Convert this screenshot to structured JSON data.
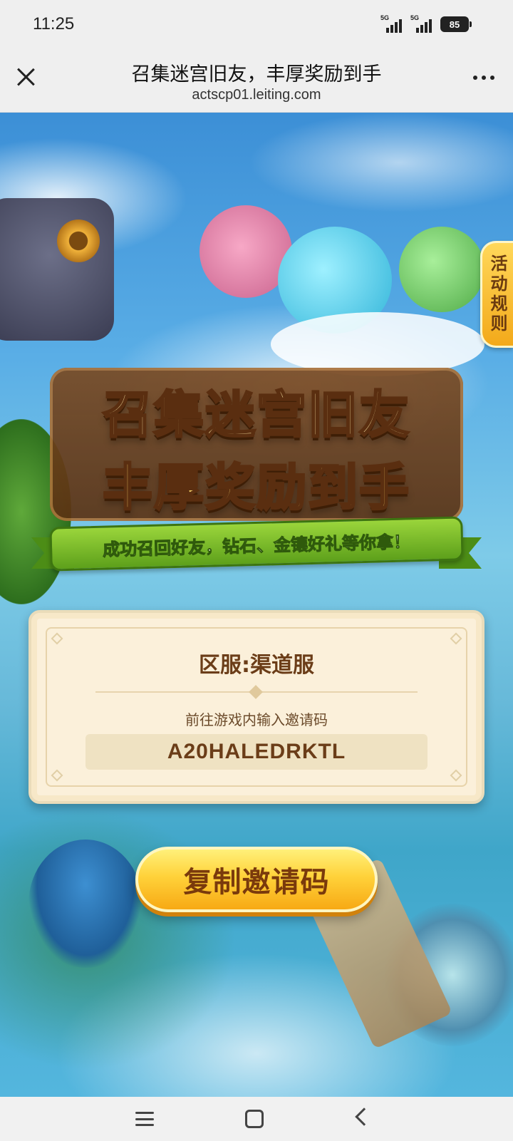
{
  "status_bar": {
    "time": "11:25",
    "signal1_tag": "5G",
    "signal2_tag": "5G",
    "battery": "85"
  },
  "browser": {
    "title": "召集迷宫旧友，丰厚奖励到手",
    "url": "actscp01.leiting.com"
  },
  "page": {
    "rules_tab": "活动规则",
    "headline_line1": "召集迷宫旧友",
    "headline_line2": "丰厚奖励到手",
    "ribbon_text": "成功召回好友，钻石、金镶好礼等你拿！",
    "card": {
      "server": "区服:渠道服",
      "hint": "前往游戏内输入邀请码",
      "invite_code": "A20HALEDRKTL"
    },
    "copy_button": "复制邀请码"
  },
  "colors": {
    "accent": "#ffd23a",
    "card_bg": "#fbf0da",
    "text_brown": "#6b3d18"
  },
  "icons": [
    "close-icon",
    "more-icon",
    "menu-icon",
    "home-icon",
    "back-icon"
  ]
}
